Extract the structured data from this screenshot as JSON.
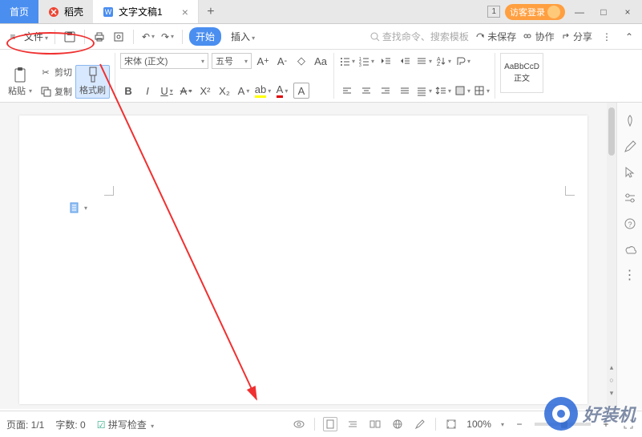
{
  "tabs": {
    "home": "首页",
    "docker": "稻壳",
    "doc": "文字文稿1",
    "badge": "1",
    "login": "访客登录"
  },
  "menu": {
    "file": "文件",
    "start": "开始",
    "insert": "插入",
    "search_placeholder": "查找命令、搜索模板",
    "unsaved": "未保存",
    "coop": "协作",
    "share": "分享"
  },
  "toolbar": {
    "paste": "粘贴",
    "cut": "剪切",
    "copy": "复制",
    "format_painter": "格式刷",
    "font_name": "宋体 (正文)",
    "font_size": "五号",
    "style_sample": "AaBbCcD",
    "style_name": "正文"
  },
  "status": {
    "page": "页面: 1/1",
    "words": "字数: 0",
    "spellcheck": "拼写检查",
    "zoom": "100%"
  },
  "watermark": "好装机"
}
